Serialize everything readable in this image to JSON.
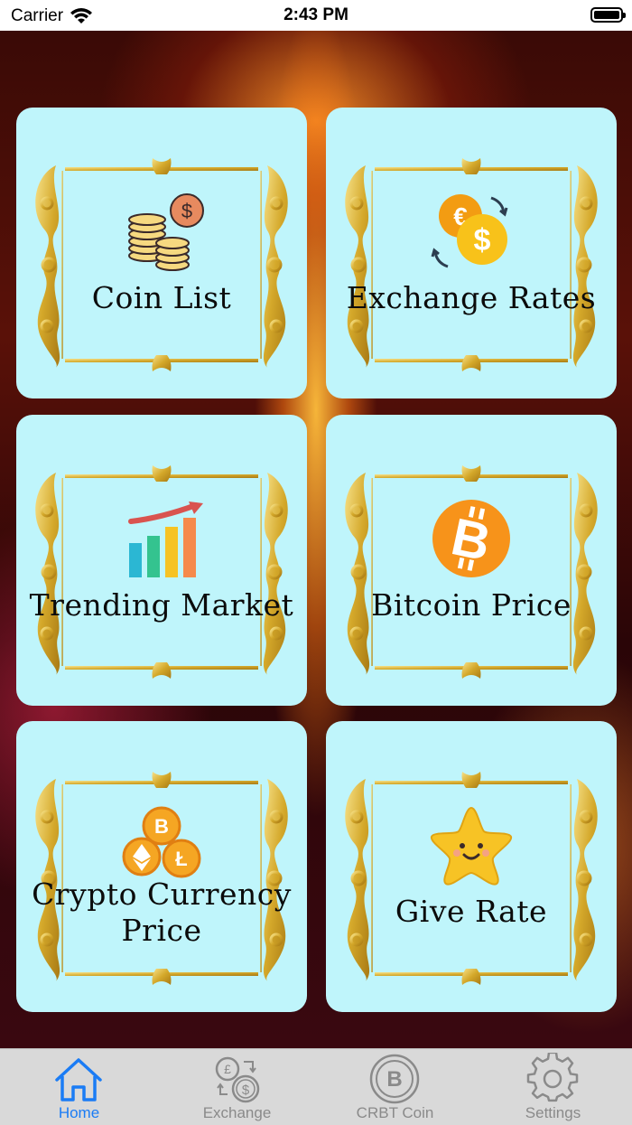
{
  "status_bar": {
    "carrier": "Carrier",
    "time": "2:43 PM"
  },
  "tiles": [
    {
      "label": "Coin List",
      "icon": "coins-stack-icon"
    },
    {
      "label": "Exchange Rates",
      "icon": "currency-exchange-icon"
    },
    {
      "label": "Trending Market",
      "icon": "trending-chart-icon"
    },
    {
      "label": "Bitcoin Price",
      "icon": "bitcoin-icon"
    },
    {
      "label_line1": "Crypto Currency",
      "label_line2": "Price",
      "icon": "crypto-coins-icon"
    },
    {
      "label": "Give Rate",
      "icon": "star-icon"
    }
  ],
  "tab_bar": {
    "items": [
      {
        "label": "Home",
        "icon": "home-icon",
        "active": true
      },
      {
        "label": "Exchange",
        "icon": "exchange-icon",
        "active": false
      },
      {
        "label": "CRBT Coin",
        "icon": "bitcoin-coin-icon",
        "active": false
      },
      {
        "label": "Settings",
        "icon": "gear-icon",
        "active": false
      }
    ]
  },
  "colors": {
    "tile_bg": "#bff5fb",
    "accent": "#1a7cf5",
    "gold": "#d4a82a"
  }
}
